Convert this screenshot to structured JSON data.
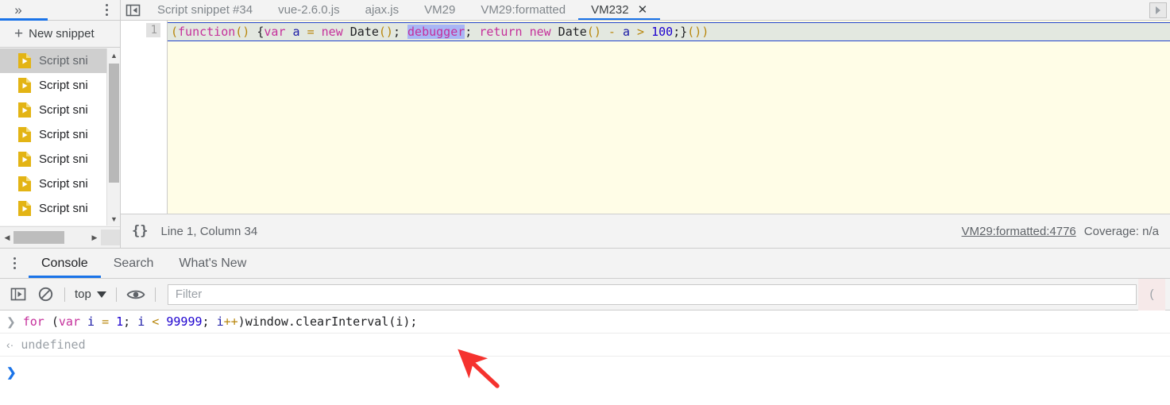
{
  "navigator": {
    "overflow_icon": "chevrons-right-icon",
    "more_icon": "kebab-menu-icon",
    "new_snippet_label": "New snippet",
    "snippets": [
      {
        "label": "Script sni",
        "icon": "script-file-icon",
        "selected": true
      },
      {
        "label": "Script sni",
        "icon": "script-file-icon",
        "selected": false
      },
      {
        "label": "Script sni",
        "icon": "script-file-icon",
        "selected": false
      },
      {
        "label": "Script sni",
        "icon": "script-file-icon",
        "selected": false
      },
      {
        "label": "Script sni",
        "icon": "script-file-icon",
        "selected": false
      },
      {
        "label": "Script sni",
        "icon": "script-file-icon",
        "selected": false
      },
      {
        "label": "Script sni",
        "icon": "script-file-icon",
        "selected": false
      }
    ]
  },
  "editor": {
    "prev_tab_icon": "panel-toggle-icon",
    "scroll_right_icon": "chevron-right-icon",
    "tabs": [
      {
        "label": "Script snippet #34",
        "active": false,
        "closable": false
      },
      {
        "label": "vue-2.6.0.js",
        "active": false,
        "closable": false
      },
      {
        "label": "ajax.js",
        "active": false,
        "closable": false
      },
      {
        "label": "VM29",
        "active": false,
        "closable": false
      },
      {
        "label": "VM29:formatted",
        "active": false,
        "closable": false
      },
      {
        "label": "VM232",
        "active": true,
        "closable": true,
        "close_label": "✕"
      }
    ],
    "line_number": "1",
    "code_tokens": [
      {
        "text": "(",
        "cls": "tok-punct"
      },
      {
        "text": "function",
        "cls": "tok-kw"
      },
      {
        "text": "()",
        "cls": "tok-punct"
      },
      {
        "text": " {",
        "cls": "tok-plain"
      },
      {
        "text": "var",
        "cls": "tok-kw"
      },
      {
        "text": " ",
        "cls": "tok-plain"
      },
      {
        "text": "a",
        "cls": "tok-var"
      },
      {
        "text": " ",
        "cls": "tok-plain"
      },
      {
        "text": "=",
        "cls": "tok-punct"
      },
      {
        "text": " ",
        "cls": "tok-plain"
      },
      {
        "text": "new",
        "cls": "tok-kw"
      },
      {
        "text": " Date",
        "cls": "tok-plain"
      },
      {
        "text": "()",
        "cls": "tok-punct"
      },
      {
        "text": "; ",
        "cls": "tok-plain"
      },
      {
        "text": "debugger",
        "cls": "tok-dbg"
      },
      {
        "text": "; ",
        "cls": "tok-plain"
      },
      {
        "text": "return",
        "cls": "tok-kw"
      },
      {
        "text": " ",
        "cls": "tok-plain"
      },
      {
        "text": "new",
        "cls": "tok-kw"
      },
      {
        "text": " Date",
        "cls": "tok-plain"
      },
      {
        "text": "()",
        "cls": "tok-punct"
      },
      {
        "text": " ",
        "cls": "tok-plain"
      },
      {
        "text": "-",
        "cls": "tok-punct"
      },
      {
        "text": " ",
        "cls": "tok-plain"
      },
      {
        "text": "a",
        "cls": "tok-var"
      },
      {
        "text": " ",
        "cls": "tok-plain"
      },
      {
        "text": ">",
        "cls": "tok-punct"
      },
      {
        "text": " ",
        "cls": "tok-plain"
      },
      {
        "text": "100",
        "cls": "tok-num"
      },
      {
        "text": ";}",
        "cls": "tok-plain"
      },
      {
        "text": "()",
        "cls": "tok-punct"
      },
      {
        "text": ")",
        "cls": "tok-punct"
      }
    ],
    "code_plain": "(function() {var a = new Date(); debugger; return new Date() - a > 100;}())",
    "status": {
      "format_icon_label": "{}",
      "cursor_position": "Line 1, Column 34",
      "source_link": "VM29:formatted:4776",
      "coverage": "Coverage: n/a"
    }
  },
  "drawer": {
    "more_icon": "kebab-menu-icon",
    "tabs": [
      {
        "label": "Console",
        "active": true
      },
      {
        "label": "Search",
        "active": false
      },
      {
        "label": "What's New",
        "active": false
      }
    ],
    "toolbar": {
      "sidebar_toggle_icon": "console-sidebar-icon",
      "clear_console_icon": "clear-console-icon",
      "context_value": "top",
      "context_caret_icon": "caret-down-icon",
      "live_expression_icon": "eye-icon",
      "filter_placeholder": "Filter",
      "levels_value": "("
    },
    "log": [
      {
        "kind": "input",
        "gutter_icon": "chevron-right-icon",
        "tokens": [
          {
            "text": "for",
            "cls": "tok-kw"
          },
          {
            "text": " (",
            "cls": "tok-plain"
          },
          {
            "text": "var",
            "cls": "tok-kw"
          },
          {
            "text": " ",
            "cls": "tok-plain"
          },
          {
            "text": "i",
            "cls": "tok-var"
          },
          {
            "text": " ",
            "cls": "tok-plain"
          },
          {
            "text": "=",
            "cls": "tok-punct"
          },
          {
            "text": " ",
            "cls": "tok-plain"
          },
          {
            "text": "1",
            "cls": "tok-num"
          },
          {
            "text": "; ",
            "cls": "tok-plain"
          },
          {
            "text": "i",
            "cls": "tok-var"
          },
          {
            "text": " ",
            "cls": "tok-plain"
          },
          {
            "text": "<",
            "cls": "tok-punct"
          },
          {
            "text": " ",
            "cls": "tok-plain"
          },
          {
            "text": "99999",
            "cls": "tok-num"
          },
          {
            "text": "; ",
            "cls": "tok-plain"
          },
          {
            "text": "i",
            "cls": "tok-var"
          },
          {
            "text": "++",
            "cls": "tok-punct"
          },
          {
            "text": ")window.clearInterval(i);",
            "cls": "tok-plain"
          }
        ],
        "plain": "for (var i = 1; i < 99999; i++)window.clearInterval(i);"
      },
      {
        "kind": "result",
        "gutter_icon": "chevron-left-icon",
        "text": "undefined"
      }
    ],
    "prompt_caret": "❯"
  },
  "annotation": {
    "arrow": "red-arrow-pointing-up-left",
    "color": "#f5322e"
  },
  "colors": {
    "accent": "#1a73e8",
    "paused_bg": "#fffde7",
    "execution_line_bg": "#e3e8e0",
    "toolbar_bg": "#f3f3f3"
  }
}
